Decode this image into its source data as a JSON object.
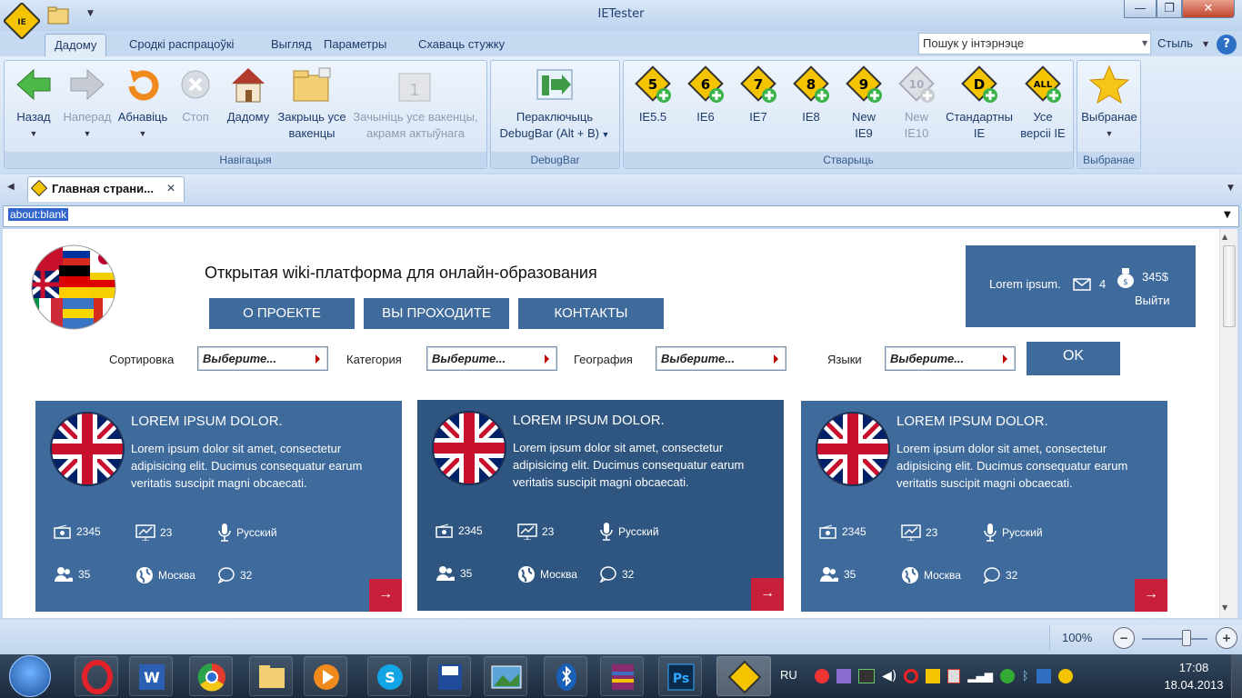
{
  "window": {
    "title": "IETester"
  },
  "menu_tabs": [
    "Дадому",
    "Сродкі распрацоўкі",
    "Выгляд",
    "Параметры",
    "Схаваць стужку"
  ],
  "search": {
    "placeholder": "Пошук у інтэрнэце"
  },
  "style_label": "Стыль",
  "ribbon": {
    "groups": {
      "navigation": "Навігацыя",
      "debugbar": "DebugBar",
      "create": "Стварыць",
      "favorites": "Выбранае"
    },
    "nav": {
      "back": "Назад",
      "forward": "Наперад",
      "refresh": "Абнавіць",
      "stop": "Стоп",
      "home": "Дадому",
      "close_all_1": "Закрыць усе",
      "close_all_2": "вакенцы",
      "close_other_1": "Зачыніць усе вакенцы,",
      "close_other_2": "акрамя актыўнага"
    },
    "debugbar": {
      "line1": "Пераключыць",
      "line2": "DebugBar (Alt + B)"
    },
    "create": {
      "ie55": "IE5.5",
      "ie6": "IE6",
      "ie7": "IE7",
      "ie8": "IE8",
      "ie9_1": "New",
      "ie9_2": "IE9",
      "ie10_1": "New",
      "ie10_2": "IE10",
      "std_1": "Стандартны",
      "std_2": "IE",
      "all_1": "Усе",
      "all_2": "версіі IE",
      "badge_ie55": "5",
      "badge_ie6": "6",
      "badge_ie7": "7",
      "badge_ie8": "8",
      "badge_ie9": "9",
      "badge_ie10": "10",
      "badge_std": "D",
      "badge_all": "ALL"
    },
    "favorites": {
      "label": "Выбранае"
    }
  },
  "doc_tab": {
    "title": "Главная страни..."
  },
  "address": {
    "value": "about:blank"
  },
  "site": {
    "headline": "Открытая wiki-платформа для онлайн-образования",
    "nav": [
      "О ПРОЕКТЕ",
      "ВЫ ПРОХОДИТЕ",
      "КОНТАКТЫ"
    ],
    "user_box": {
      "name": "Lorem ipsum.",
      "messages": "4",
      "balance": "345$",
      "logout": "Выйти"
    },
    "filters": [
      {
        "label": "Сортировка",
        "value": "Выберите..."
      },
      {
        "label": "Категория",
        "value": "Выберите..."
      },
      {
        "label": "География",
        "value": "Выберите..."
      },
      {
        "label": "Языки",
        "value": "Выберите..."
      }
    ],
    "ok": "OK",
    "cards": [
      {
        "title": "LOREM IPSUM DOLOR.",
        "text": "Lorem ipsum dolor sit amet, consectetur adipisicing elit. Ducimus consequatur earum veritatis suscipit magni obcaecati.",
        "price": "2345",
        "lessons": "23",
        "language": "Русский",
        "users": "35",
        "city": "Москва",
        "comments": "32",
        "arrow": "→"
      },
      {
        "title": "LOREM IPSUM DOLOR.",
        "text": "Lorem ipsum dolor sit amet, consectetur adipisicing elit. Ducimus consequatur earum veritatis suscipit magni obcaecati.",
        "price": "2345",
        "lessons": "23",
        "language": "Русский",
        "users": "35",
        "city": "Москва",
        "comments": "32",
        "arrow": "→"
      },
      {
        "title": "LOREM IPSUM DOLOR.",
        "text": "Lorem ipsum dolor sit amet, consectetur adipisicing elit. Ducimus consequatur earum veritatis suscipit magni obcaecati.",
        "price": "2345",
        "lessons": "23",
        "language": "Русский",
        "users": "35",
        "city": "Москва",
        "comments": "32",
        "arrow": "→"
      }
    ]
  },
  "status": {
    "zoom": "100%",
    "zoom_level": 0.68
  },
  "taskbar": {
    "lang": "RU",
    "time": "17:08",
    "date": "18.04.2013"
  },
  "colors": {
    "card": "#3e6a9c",
    "card_active": "#2e5680",
    "arrow": "#c8203a"
  }
}
